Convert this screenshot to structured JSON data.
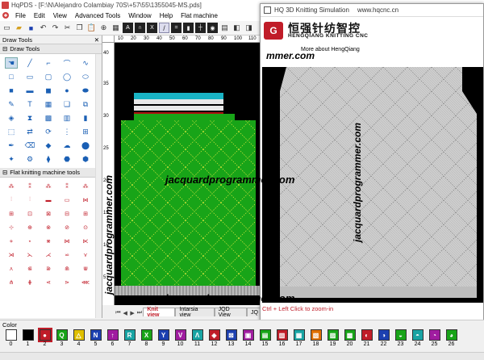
{
  "app": {
    "title": "HqPDS - [F:\\N\\Alejandro Colambiay 70S\\+57\\55\\1355045-MS.pds]"
  },
  "menu": [
    "File",
    "Edit",
    "View",
    "Advanced Tools",
    "Window",
    "Help",
    "Flat machine"
  ],
  "left_panel": {
    "title": "Draw Tools",
    "section1": "Draw Tools",
    "section2": "Flat knitting machine tools"
  },
  "canvas_tabs": [
    "Knit view",
    "Intarsia view",
    "JQD View",
    "JQ"
  ],
  "ruler": {
    "h": [
      "10",
      "20",
      "30",
      "40",
      "50",
      "60",
      "70",
      "80",
      "90",
      "100",
      "110"
    ],
    "v": [
      "40",
      "35",
      "30",
      "25",
      "20",
      "15",
      "10",
      "5"
    ]
  },
  "sim": {
    "title": "HQ 3D Knitting Simulation",
    "url": "www.hqcnc.cn",
    "brand_cn": "恒强针纺智控",
    "brand_en": "HENGQIANG KNITTING CNC",
    "tab_about": "More about HengQiang",
    "hint": "Ctrl + Left Click to zoom-in"
  },
  "watermarks": {
    "text": "jacquardprogrammer.com",
    "partial": "mmer.com"
  },
  "color_section": "Color",
  "colors": [
    {
      "num": "0",
      "hex": "#ffffff"
    },
    {
      "num": "1",
      "hex": "#000000"
    },
    {
      "num": "2",
      "hex": "#c01c28"
    },
    {
      "num": "3",
      "hex": "#18a418"
    },
    {
      "num": "4",
      "hex": "#e0c000"
    },
    {
      "num": "5",
      "hex": "#1c40b0"
    },
    {
      "num": "6",
      "hex": "#a01ca0"
    },
    {
      "num": "7",
      "hex": "#18a4a4"
    },
    {
      "num": "8",
      "hex": "#18a418"
    },
    {
      "num": "9",
      "hex": "#1c40b0"
    },
    {
      "num": "10",
      "hex": "#a01ca0"
    },
    {
      "num": "11",
      "hex": "#18a4a4"
    },
    {
      "num": "12",
      "hex": "#c01c28"
    },
    {
      "num": "13",
      "hex": "#1c40b0"
    },
    {
      "num": "14",
      "hex": "#a01ca0"
    },
    {
      "num": "15",
      "hex": "#18a418"
    },
    {
      "num": "16",
      "hex": "#c01c28"
    },
    {
      "num": "17",
      "hex": "#18a4a4"
    },
    {
      "num": "18",
      "hex": "#e07000"
    },
    {
      "num": "19",
      "hex": "#18a418"
    },
    {
      "num": "20",
      "hex": "#18a418"
    },
    {
      "num": "21",
      "hex": "#c01c28"
    },
    {
      "num": "22",
      "hex": "#1c40b0"
    },
    {
      "num": "23",
      "hex": "#18a418"
    },
    {
      "num": "24",
      "hex": "#18a4a4"
    },
    {
      "num": "25",
      "hex": "#a01ca0"
    },
    {
      "num": "26",
      "hex": "#18a418"
    }
  ]
}
